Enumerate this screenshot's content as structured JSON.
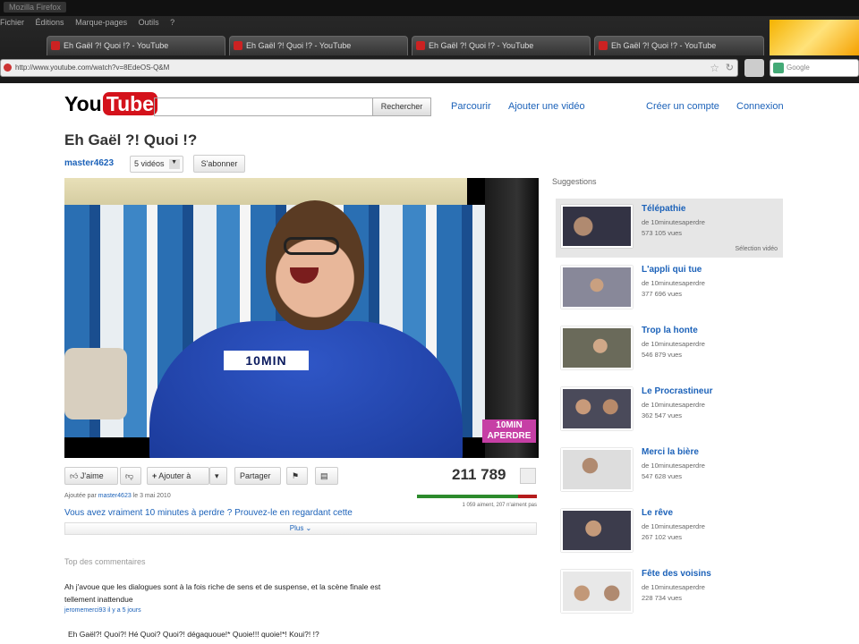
{
  "browser": {
    "window_title": "Mozilla Firefox",
    "menu": [
      "Fichier",
      "Éditions",
      "Marque-pages",
      "Outils",
      "?"
    ],
    "tabs": [
      "Eh Gaël ?! Quoi !? - YouTube",
      "Eh Gaël ?! Quoi !? - YouTube",
      "Eh Gaël ?! Quoi !? - YouTube",
      "Eh Gaël ?! Quoi !? - YouTube"
    ],
    "url": "http://www.youtube.com/watch?v=8EdeOS-Q&M",
    "search_placeholder": "Google"
  },
  "header": {
    "logo_you": "You",
    "logo_tube": "Tube",
    "search_button": "Rechercher",
    "browse": "Parcourir",
    "upload": "Ajouter une vidéo",
    "create_account": "Créer un compte",
    "login": "Connexion"
  },
  "video": {
    "title": "Eh Gaël ?! Quoi !?",
    "channel": "master4623",
    "videos_count": "5 vidéos",
    "subscribe": "S'abonner",
    "shirt_text": "10MIN",
    "watermark": "10MIN\nAPERDRE",
    "views": "211 789",
    "uploaded_prefix": "Ajoutée par",
    "uploaded_by": "master4623",
    "uploaded_date": "le 3 mai 2010",
    "likes_text": "1 059 aiment, 207 n'aiment pas",
    "like_ratio": 0.84,
    "description": "Vous avez vraiment 10 minutes à perdre ? Prouvez-le en regardant cette",
    "more": "Plus"
  },
  "actions": {
    "like": "J'aime",
    "add_to": "Ajouter à",
    "share": "Partager"
  },
  "comments": {
    "heading": "Top des commentaires",
    "top_text": "Ah j'avoue que les dialogues sont à la fois riche de sens et de suspense, et la scène finale est tellement inattendue",
    "top_meta": "jeromemerci93 il y a 5 jours",
    "second_text": "Eh Gaël?! Quoi?! Hé Quoi? Quoi?! dégaquoue!* Quoie!!! quoie!*! Koui?! !?"
  },
  "suggestions": {
    "heading": "Suggestions",
    "selected_label": "Sélection vidéo",
    "items": [
      {
        "title": "Télépathie",
        "by": "de 10minutesaperdre",
        "views": "573 105 vues"
      },
      {
        "title": "L'appli qui tue",
        "by": "de 10minutesaperdre",
        "views": "377 696 vues"
      },
      {
        "title": "Trop la honte",
        "by": "de 10minutesaperdre",
        "views": "546 879 vues"
      },
      {
        "title": "Le Procrastineur",
        "by": "de 10minutesaperdre",
        "views": "362 547 vues"
      },
      {
        "title": "Merci la bière",
        "by": "de 10minutesaperdre",
        "views": "547 628 vues"
      },
      {
        "title": "Le rêve",
        "by": "de 10minutesaperdre",
        "views": "267 102 vues"
      },
      {
        "title": "Fête des voisins",
        "by": "de 10minutesaperdre",
        "views": "228 734 vues"
      }
    ]
  }
}
